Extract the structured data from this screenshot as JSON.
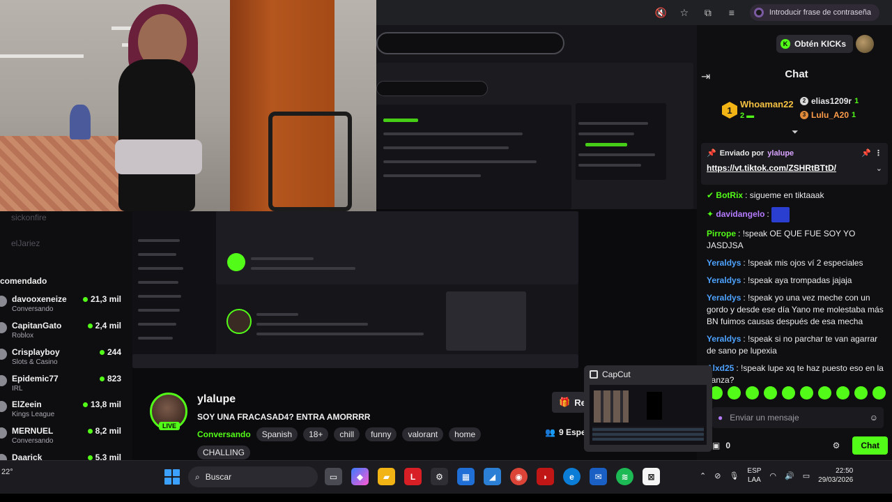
{
  "browser": {
    "password_pill": "Introducir frase de contraseña"
  },
  "header": {
    "kicks_button": "Obtén KICKs"
  },
  "chat": {
    "title": "Chat",
    "gifters": [
      {
        "rank": "1",
        "name": "Whoaman22",
        "count": "2"
      },
      {
        "name": "elias1209r",
        "count": "1"
      },
      {
        "name": "Lulu_A20",
        "count": "1"
      }
    ],
    "pinned": {
      "label": "Enviado por",
      "user": "ylalupe",
      "link": "https://vt.tiktok.com/ZSHRtBTtD/"
    },
    "messages": [
      {
        "user": "BotRix",
        "text": "sigueme en tiktaaak",
        "color": "#53fc18"
      },
      {
        "user": "davidangelo",
        "text": "",
        "color": "#b57cff",
        "emote": true
      },
      {
        "user": "Pirrope",
        "text": "!speak OE QUE FUE SOY YO JASDJSA",
        "color": "#53fc18"
      },
      {
        "user": "Yeraldys",
        "text": "!speak mis ojos ví 2 especiales",
        "color": "#4da3ff"
      },
      {
        "user": "Yeraldys",
        "text": "!speak aya trompadas jajaja",
        "color": "#4da3ff"
      },
      {
        "user": "Yeraldys",
        "text": "!speak yo una vez meche con un gordo y desde ese día Yano me molestaba más BN fuimos causas después de esa mecha",
        "color": "#4da3ff"
      },
      {
        "user": "Yeraldys",
        "text": "!speak si no parchar te van agarrar de sano pe lupexia",
        "color": "#4da3ff"
      },
      {
        "user": "Alxd25",
        "text": "!speak lupe xq te haz puesto eso en la panza?",
        "color": "#4da3ff"
      }
    ],
    "input_placeholder": "Enviar un mensaje",
    "points": "0",
    "send_label": "Chat"
  },
  "sidebar": {
    "ghost_users": [
      "sickonfire",
      "elJariez"
    ],
    "recommended_label": "comendado",
    "channels": [
      {
        "name": "davooxeneize",
        "category": "Conversando",
        "viewers": "21,3 mil"
      },
      {
        "name": "CapitanGato",
        "category": "Roblox",
        "viewers": "2,4 mil"
      },
      {
        "name": "Crisplayboy",
        "category": "Slots & Casino",
        "viewers": "244"
      },
      {
        "name": "Epidemic77",
        "category": "IRL",
        "viewers": "823"
      },
      {
        "name": "ElZeein",
        "category": "Kings League",
        "viewers": "13,8 mil"
      },
      {
        "name": "MERNUEL",
        "category": "Conversando",
        "viewers": "8,2 mil"
      },
      {
        "name": "Daarick",
        "category": "",
        "viewers": "5,3 mil"
      }
    ]
  },
  "stream": {
    "streamer": "ylalupe",
    "live_badge": "LIVE",
    "title": "SOY UNA FRACASAD4? ENTRA AMORRRR",
    "category": "Conversando",
    "tags": [
      "Spanish",
      "18+",
      "chill",
      "funny",
      "valorant",
      "home"
    ],
    "extra_tag": "CHALLING",
    "recommend_button": "Re",
    "viewers": "9 Espe"
  },
  "capcut": {
    "title": "CapCut"
  },
  "taskbar": {
    "temp": "22°",
    "search_label": "Buscar",
    "lang_top": "ESP",
    "lang_bottom": "LAA",
    "time": "22:50",
    "date": "29/03/2026"
  }
}
